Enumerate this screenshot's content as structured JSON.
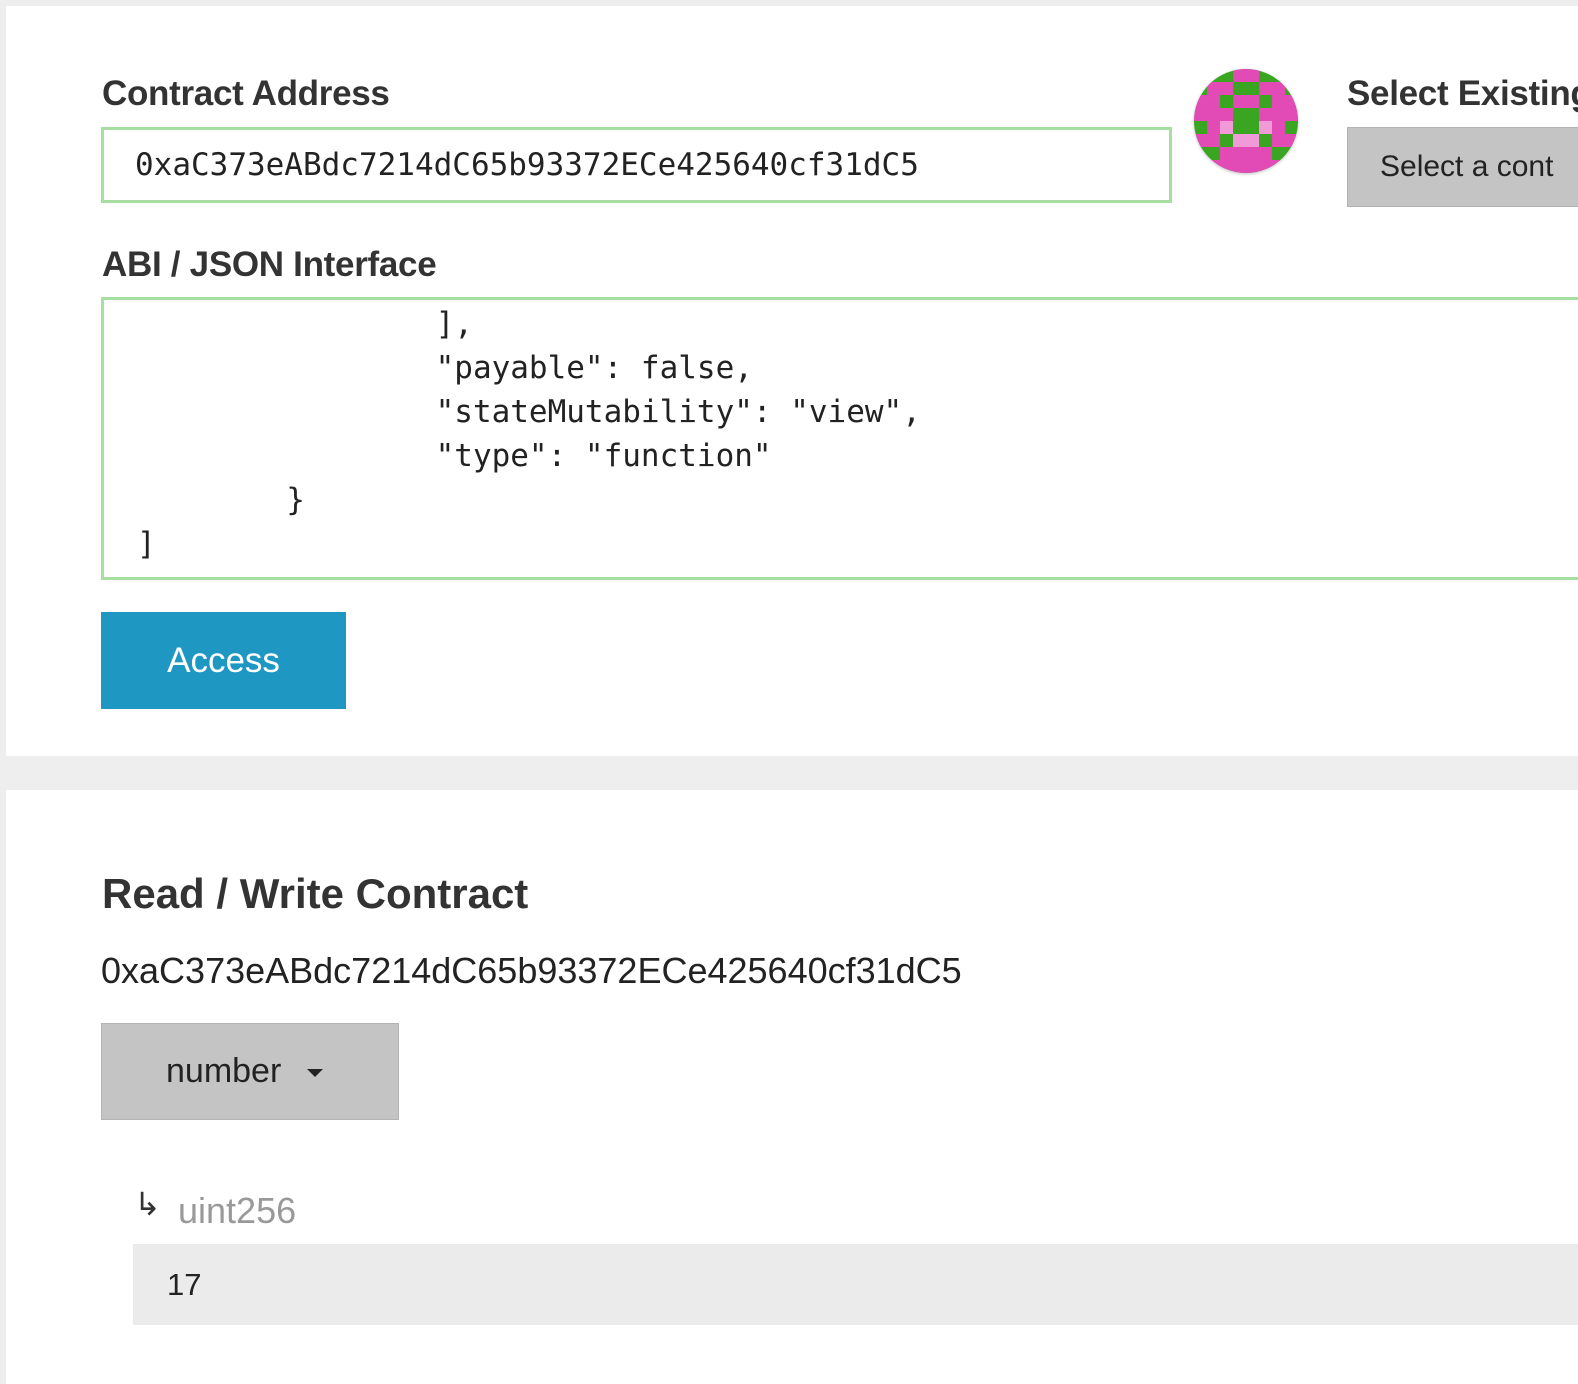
{
  "contract_access": {
    "address_label": "Contract Address",
    "address_value": "0xaC373eABdc7214dC65b93372ECe425640cf31dC5",
    "select_existing_label": "Select Existing",
    "select_button_text": "Select a cont",
    "abi_label": "ABI / JSON Interface",
    "abi_lines": [
      "                ],",
      "                \"payable\": false,",
      "                \"stateMutability\": \"view\",",
      "                \"type\": \"function\"",
      "        }",
      "]"
    ],
    "access_button": "Access"
  },
  "read_write": {
    "title": "Read / Write Contract",
    "address": "0xaC373eABdc7214dC65b93372ECe425640cf31dC5",
    "function_selected": "number",
    "return_arrow": "↳",
    "return_type": "uint256",
    "return_value": "17"
  },
  "colors": {
    "accent": "#1e97c3",
    "input_border": "#a5e0a2",
    "identicon_green": "#3aa520",
    "identicon_pink": "#e24bb6",
    "identicon_light_pink": "#f29ad8"
  },
  "icons": [
    "identicon-avatar",
    "dropdown-caret-icon",
    "return-arrow-icon"
  ]
}
